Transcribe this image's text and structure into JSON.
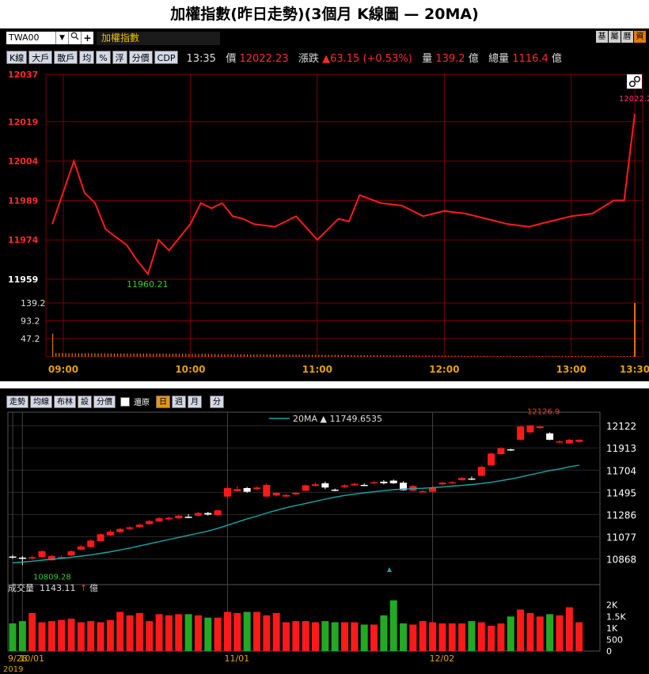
{
  "title": "加權指數(昨日走勢)(3個月 K線圖 — 20MA)",
  "top": {
    "code": "TWA00",
    "dropdown_icon": "▼",
    "search_icon": "search-icon",
    "add_icon": "+",
    "name": "加權指數",
    "right_buttons": [
      "基",
      "屬",
      "曆",
      "資"
    ],
    "tabs": [
      "K線",
      "大戶",
      "散戶",
      "均",
      "%",
      "浮",
      "分價",
      "CDP"
    ],
    "time": "13:35",
    "price_label": "價",
    "price": "12022.23",
    "change_label": "漲跌",
    "change": "▲63.15 (+0.53%)",
    "volume_label": "量",
    "volume": "139.2",
    "volume_unit": "億",
    "total_label": "總量",
    "total": "1116.4",
    "total_unit": "億",
    "y_labels": [
      "12037",
      "12019",
      "12004",
      "11989",
      "11974",
      "11959"
    ],
    "vol_labels": [
      "139.2",
      "93.2",
      "47.2"
    ],
    "x_labels": [
      "09:00",
      "10:00",
      "11:00",
      "12:00",
      "13:00",
      "13:30"
    ],
    "low_label": "11960.21",
    "last_label": "12022.2",
    "link_icon": "link-icon"
  },
  "bottom": {
    "tabs": [
      "走勢",
      "均線",
      "布林",
      "設",
      "分價"
    ],
    "restore_label": "還原",
    "period_tabs": [
      "日",
      "週",
      "月"
    ],
    "minute_tab": "分",
    "ma_legend": "20MA ▲ 11749.6535",
    "high_label": "12126.9",
    "low_label": "10809.28",
    "y_labels": [
      "12122",
      "11913",
      "11704",
      "11495",
      "11286",
      "11077",
      "10868"
    ],
    "vol_title": "成交量",
    "vol_value": "1143.11",
    "vol_arrow": "↑",
    "vol_unit": "億",
    "vol_y_labels": [
      "2K",
      "1.5K",
      "1K",
      "500",
      "0"
    ],
    "x_labels": [
      "9/28",
      "10/01",
      "11/01",
      "12/02"
    ],
    "year": "2019"
  },
  "colors": {
    "up": "#ff1a1a",
    "down": "#ffffff",
    "ma": "#1aa6a6",
    "vol_up": "#ff1a1a",
    "vol_down": "#22aa22",
    "grid": "#7a0000",
    "gold": "#e6a000"
  },
  "chart_data": [
    {
      "type": "line",
      "x": [
        "09:00",
        "09:05",
        "09:10",
        "09:15",
        "09:20",
        "09:25",
        "09:30",
        "09:35",
        "09:40",
        "09:45",
        "09:50",
        "09:55",
        "10:00",
        "10:05",
        "10:10",
        "10:15",
        "10:20",
        "10:25",
        "10:30",
        "10:40",
        "10:50",
        "11:00",
        "11:10",
        "11:15",
        "11:20",
        "11:30",
        "11:40",
        "11:50",
        "12:00",
        "12:10",
        "12:20",
        "12:30",
        "12:40",
        "12:50",
        "13:00",
        "13:10",
        "13:20",
        "13:25",
        "13:30"
      ],
      "values": [
        11980,
        12004,
        11992,
        11988,
        11978,
        11975,
        11972,
        11966,
        11961,
        11974,
        11970,
        11975,
        11980,
        11988,
        11986,
        11988,
        11983,
        11982,
        11980,
        11979,
        11983,
        11974,
        11982,
        11981,
        11991,
        11988,
        11987,
        11983,
        11985,
        11984,
        11982,
        11980,
        11979,
        11981,
        11983,
        11984,
        11989,
        11989,
        12022
      ],
      "low": 11960.21,
      "last": 12022.23,
      "volume": [
        139.2,
        30,
        22,
        16,
        14,
        12,
        10,
        9,
        9,
        8,
        8,
        8,
        8,
        7,
        7,
        7,
        7,
        7,
        6,
        6,
        6,
        6,
        6,
        6,
        6,
        6,
        6,
        6,
        6,
        6,
        6,
        6,
        6,
        6,
        6,
        6,
        7,
        8,
        139.2
      ],
      "ylim": [
        11959,
        12037
      ],
      "vol_ylim": [
        0,
        139.2
      ]
    },
    {
      "type": "candlestick",
      "x": [
        "9/27",
        "10/01",
        "10/02",
        "10/03",
        "10/04",
        "10/07",
        "10/08",
        "10/09",
        "10/14",
        "10/15",
        "10/16",
        "10/17",
        "10/18",
        "10/21",
        "10/22",
        "10/23",
        "10/24",
        "10/25",
        "10/28",
        "10/29",
        "10/30",
        "10/31",
        "11/01",
        "11/04",
        "11/05",
        "11/06",
        "11/07",
        "11/08",
        "11/11",
        "11/12",
        "11/13",
        "11/14",
        "11/15",
        "11/18",
        "11/19",
        "11/20",
        "11/21",
        "11/22",
        "11/25",
        "11/26",
        "11/27",
        "11/28",
        "11/29",
        "12/02",
        "12/03",
        "12/04",
        "12/05",
        "12/06",
        "12/09",
        "12/10",
        "12/11",
        "12/12",
        "12/13",
        "12/16",
        "12/17",
        "12/18",
        "12/19",
        "12/20",
        "12/23"
      ],
      "open": [
        10890,
        10880,
        10880,
        10885,
        10855,
        10880,
        10900,
        10955,
        10980,
        11035,
        11090,
        11120,
        11150,
        11168,
        11195,
        11220,
        11240,
        11250,
        11265,
        11275,
        11300,
        11280,
        11455,
        11505,
        11535,
        11525,
        11455,
        11465,
        11455,
        11475,
        11510,
        11555,
        11580,
        11520,
        11545,
        11560,
        11565,
        11585,
        11595,
        11605,
        11585,
        11510,
        11505,
        11500,
        11570,
        11580,
        11610,
        11625,
        11650,
        11750,
        11855,
        11900,
        11990,
        12060,
        12100,
        12050,
        11975,
        11955,
        11970
      ],
      "close": [
        10880,
        10875,
        10885,
        10940,
        10895,
        10885,
        10940,
        10985,
        11040,
        11100,
        11125,
        11150,
        11165,
        11190,
        11225,
        11250,
        11255,
        11275,
        11260,
        11300,
        11285,
        11325,
        11535,
        11525,
        11500,
        11540,
        11565,
        11490,
        11470,
        11490,
        11560,
        11570,
        11540,
        11510,
        11560,
        11575,
        11560,
        11590,
        11580,
        11580,
        11515,
        11555,
        11505,
        11540,
        11585,
        11590,
        11630,
        11620,
        11735,
        11860,
        11910,
        11890,
        12115,
        12125,
        12115,
        11990,
        11975,
        11990,
        11990
      ],
      "high": [
        10905,
        10895,
        10900,
        10950,
        10905,
        10900,
        10950,
        11000,
        11055,
        11110,
        11140,
        11160,
        11175,
        11200,
        11235,
        11260,
        11265,
        11285,
        11290,
        11310,
        11310,
        11330,
        11545,
        11555,
        11545,
        11550,
        11580,
        11495,
        11480,
        11500,
        11570,
        11585,
        11595,
        11530,
        11570,
        11585,
        11580,
        11600,
        11610,
        11615,
        11600,
        11565,
        11525,
        11555,
        11595,
        11600,
        11640,
        11645,
        11745,
        11870,
        11920,
        11905,
        12120,
        12126.9,
        12120,
        12060,
        11985,
        11998,
        11995
      ],
      "low": [
        10870,
        10809.28,
        10860,
        10880,
        10850,
        10865,
        10895,
        10950,
        10975,
        11030,
        11085,
        11110,
        11140,
        11160,
        11190,
        11215,
        11230,
        11245,
        11250,
        11270,
        11275,
        11280,
        11450,
        11500,
        11490,
        11515,
        11450,
        11455,
        11450,
        11470,
        11505,
        11550,
        11525,
        11505,
        11535,
        11555,
        11555,
        11575,
        11570,
        11575,
        11510,
        11505,
        11495,
        11490,
        11560,
        11575,
        11605,
        11610,
        11645,
        11745,
        11850,
        11885,
        11985,
        12050,
        12095,
        11985,
        11960,
        11950,
        11960
      ],
      "ma20": [
        10830,
        10838,
        10846,
        10855,
        10864,
        10873,
        10883,
        10894,
        10906,
        10920,
        10935,
        10952,
        10970,
        10990,
        11010,
        11030,
        11050,
        11070,
        11090,
        11110,
        11130,
        11155,
        11185,
        11215,
        11245,
        11270,
        11300,
        11325,
        11350,
        11370,
        11390,
        11410,
        11430,
        11450,
        11465,
        11478,
        11490,
        11500,
        11510,
        11520,
        11525,
        11530,
        11533,
        11538,
        11545,
        11553,
        11560,
        11568,
        11578,
        11590,
        11605,
        11620,
        11640,
        11660,
        11680,
        11700,
        11715,
        11735,
        11749.6535
      ],
      "volume": [
        1200,
        1300,
        1650,
        1250,
        1300,
        1350,
        1400,
        1250,
        1300,
        1250,
        1350,
        1700,
        1550,
        1650,
        1300,
        1600,
        1550,
        1600,
        1600,
        1550,
        1450,
        1450,
        1700,
        1650,
        1700,
        1700,
        1550,
        1650,
        1250,
        1300,
        1300,
        1250,
        1300,
        1250,
        1250,
        1250,
        1150,
        1150,
        1550,
        2200,
        1200,
        1150,
        1300,
        1250,
        1200,
        1200,
        1200,
        1300,
        1250,
        1100,
        1200,
        1500,
        1800,
        1650,
        1500,
        1600,
        1550,
        1900,
        1250
      ],
      "ylim": [
        10700,
        12250
      ],
      "vol_ylim": [
        0,
        2300
      ]
    }
  ]
}
